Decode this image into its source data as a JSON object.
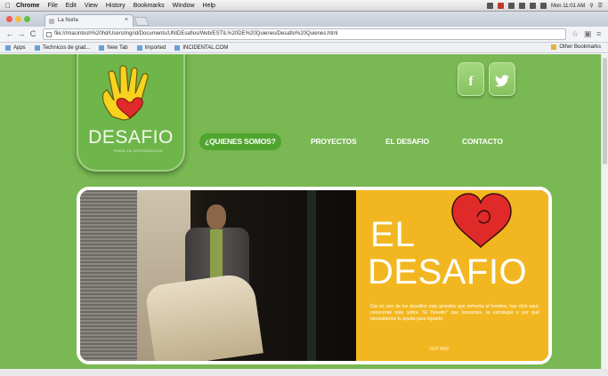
{
  "menubar": {
    "app": "Chrome",
    "items": [
      "File",
      "Edit",
      "View",
      "History",
      "Bookmarks",
      "Window",
      "Help"
    ],
    "clock": "Mon 11:01 AM"
  },
  "browser": {
    "tab_title": "La Nurla",
    "tab_close": "×",
    "back": "←",
    "forward": "→",
    "reload": "C",
    "url": "file:///macintosh%20hd/Users/ingrid/Documents/UNIDEsafios/Web/ESTIL%20DE%20Quienes/Desafio%20Quienes.html",
    "bookmarks": [
      "Apps",
      "Technicos de grad...",
      "New Tab",
      "Imported",
      "INCIDENTAL.COM"
    ],
    "other_bookmarks": "Other Bookmarks"
  },
  "site": {
    "logo_title": "DESAFIO",
    "logo_sub": "PARA LA INTEGRACION",
    "social_facebook": "f",
    "nav": [
      "¿QUIENES SOMOS?",
      "PROYECTOS",
      "EL DESAFIO",
      "CONTACTO"
    ],
    "slide": {
      "headline_1": "EL",
      "headline_2": "DESAFIO",
      "body": "Dar es uno de los desafios más grandes que enfrenta el hombre, haz click aquí, conocerás más sobre \"El Desafio\" que lanzamos, la estrategia y por qué necesitamos tu ayuda para lograrlo.",
      "button": "VER MÁS"
    }
  },
  "colors": {
    "page_bg": "#79b853",
    "logo_bg": "#6fb64a",
    "nav_active": "#4fa52e",
    "panel": "#f2b720",
    "heart": "#e02a2a"
  }
}
